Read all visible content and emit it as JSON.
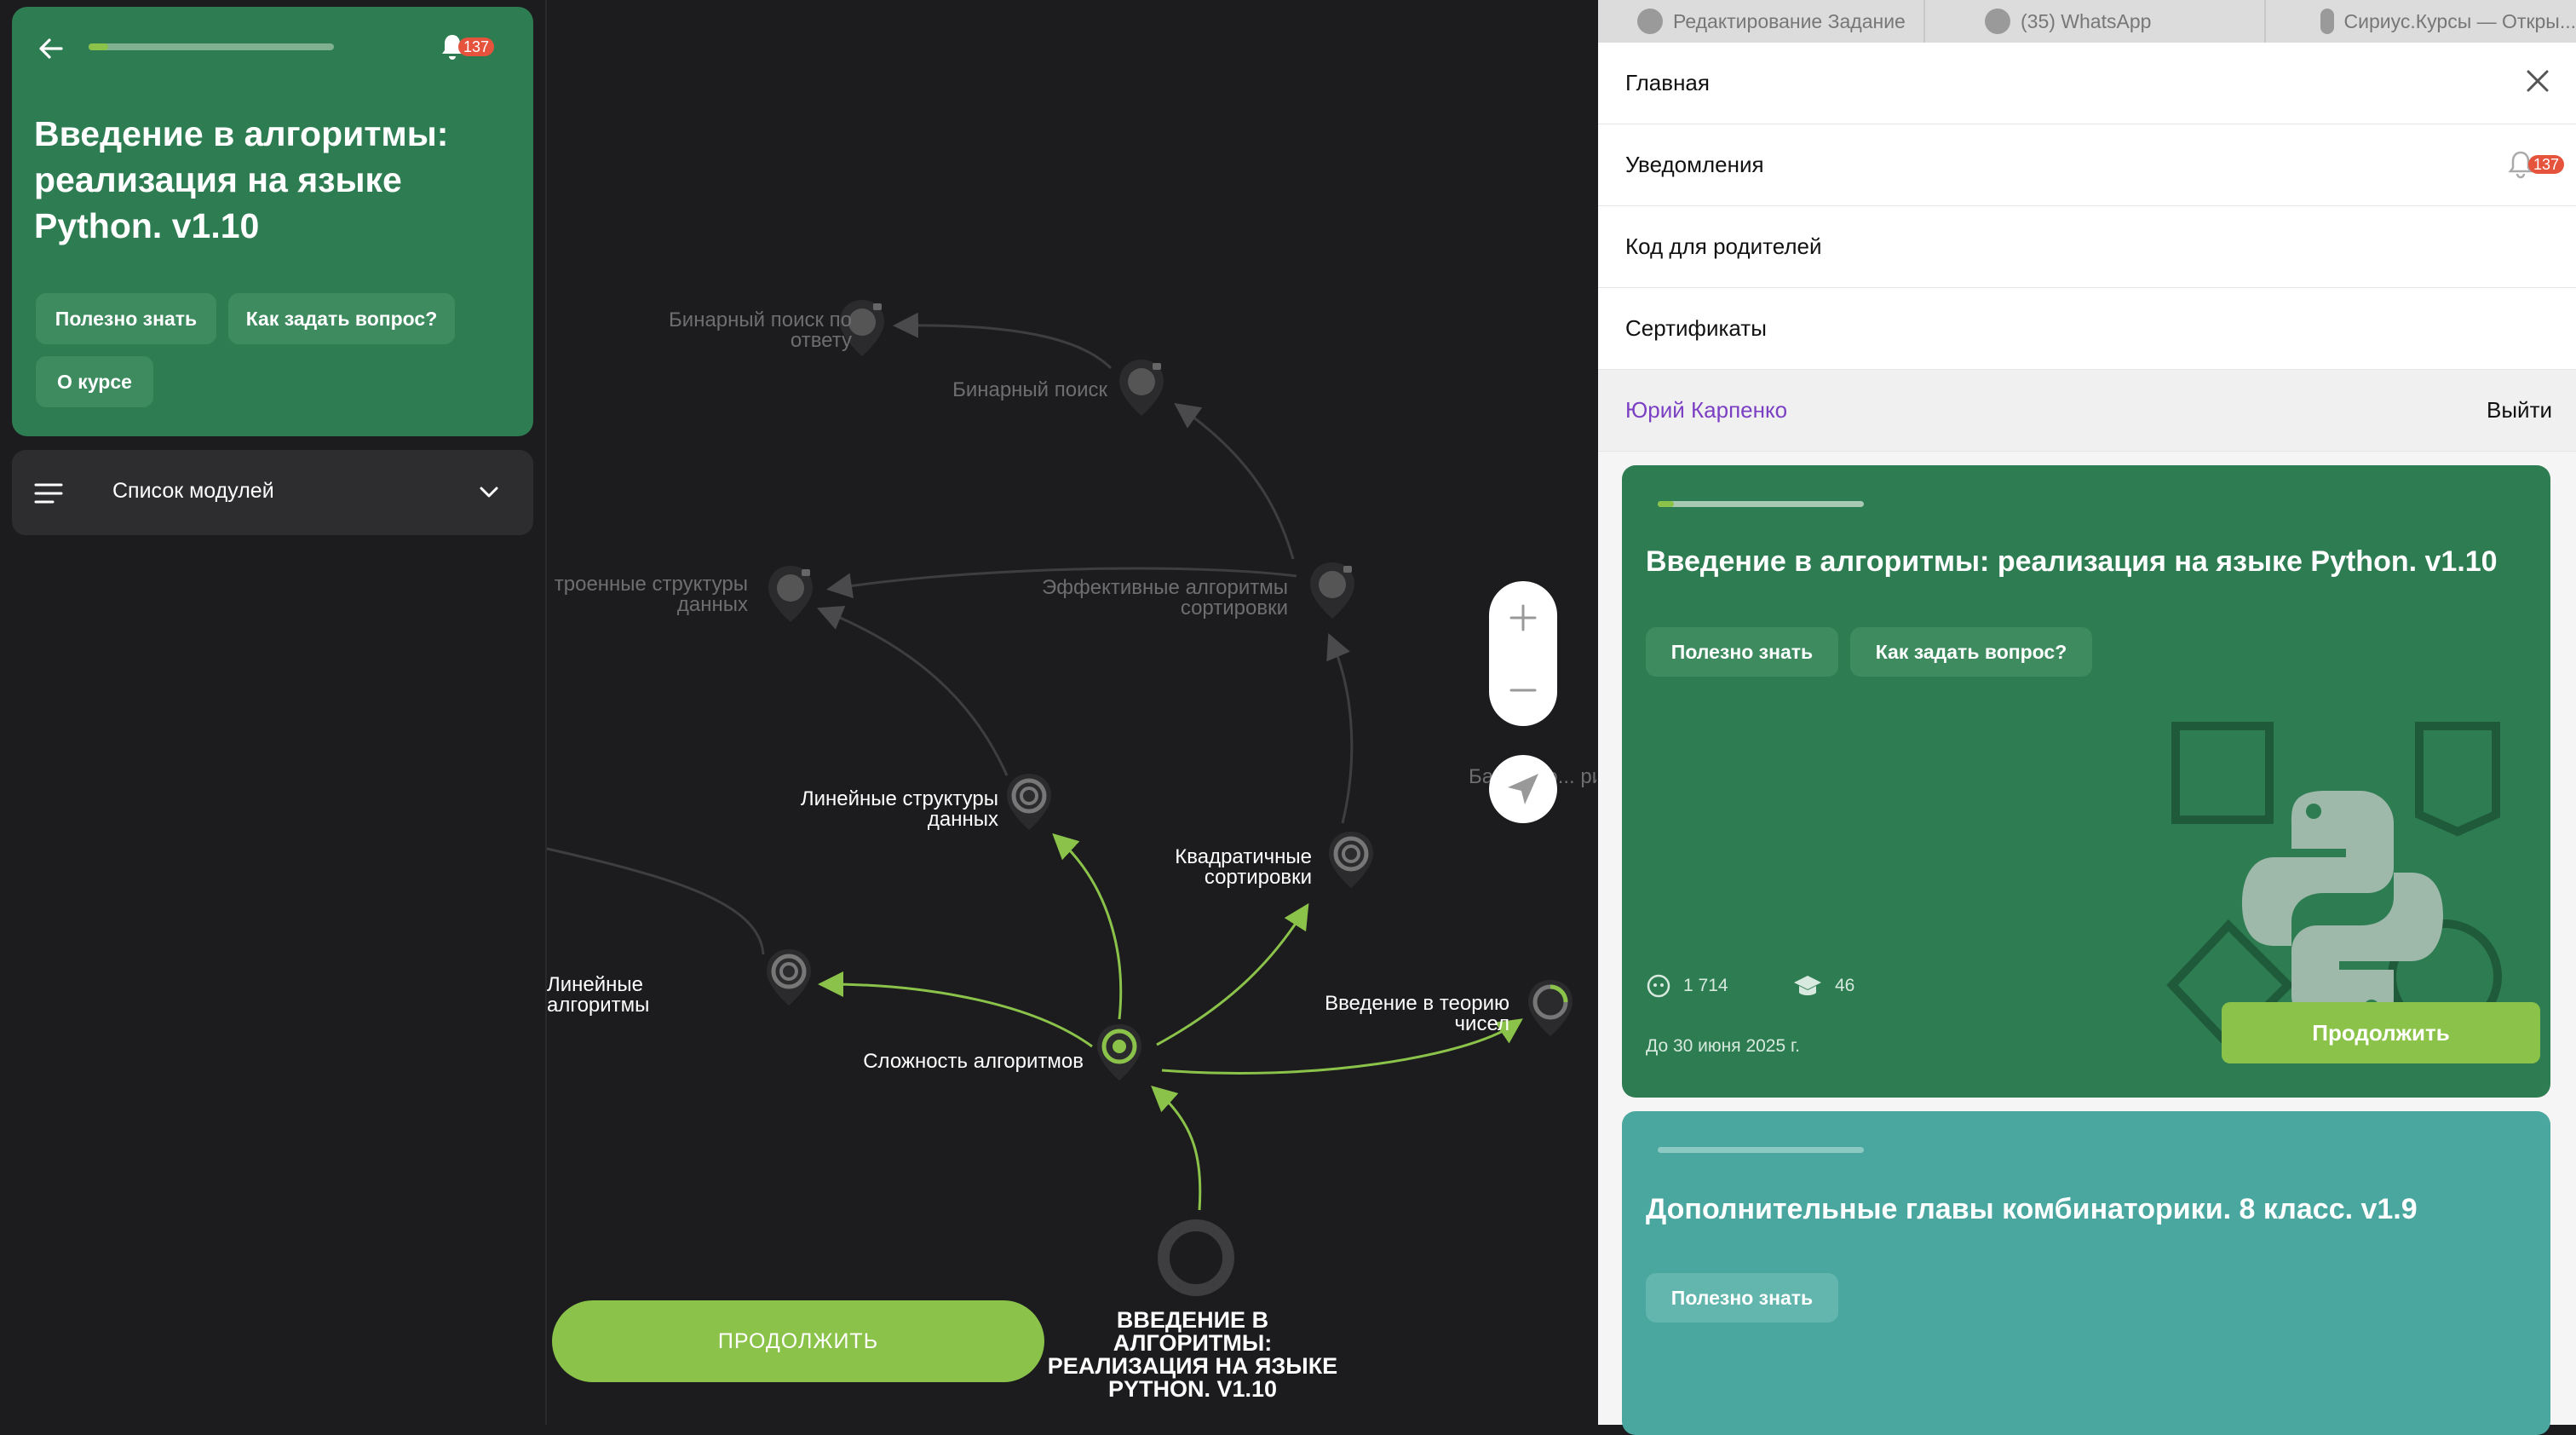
{
  "left": {
    "course_title": "Введение в алгоритмы: реализация на языке Python. v1.10",
    "progress_fraction": 0.08,
    "notifications_count": "137",
    "chips": [
      "Полезно знать",
      "Как задать вопрос?",
      "О курсе"
    ],
    "modules_label": "Список модулей"
  },
  "map": {
    "nodes": [
      {
        "label": "Бинарный поиск по ответу",
        "locked": true
      },
      {
        "label": "Бинарный поиск",
        "locked": true
      },
      {
        "label": "троенные структуры данных",
        "locked": true
      },
      {
        "label": "Эффективные алгоритмы сортировки",
        "locked": true
      },
      {
        "label": "Линейные структуры данных",
        "locked": false
      },
      {
        "label": "Квадратичные сортировки",
        "locked": false
      },
      {
        "label": "Линейные алгоритмы",
        "locked": false
      },
      {
        "label": "Сложность алгоритмов",
        "locked": false
      },
      {
        "label": "Введение в теорию чисел",
        "locked": false
      }
    ],
    "partial_label": "Ба... алго... рит...",
    "continue_label": "ПРОДОЛЖИТЬ",
    "start_title": "ВВЕДЕНИЕ В АЛГОРИТМЫ: РЕАЛИЗАЦИЯ НА ЯЗЫКЕ PYTHON. V1.10"
  },
  "browser_tabs": [
    {
      "label": "Редактирование Задание"
    },
    {
      "label": "(35) WhatsApp"
    },
    {
      "label": "Сириус.Курсы — Откры..."
    }
  ],
  "menu": {
    "home": "Главная",
    "notifications": "Уведомления",
    "notifications_count": "137",
    "parent_code": "Код для родителей",
    "certificates": "Сертификаты",
    "user_name": "Юрий Карпенко",
    "logout": "Выйти"
  },
  "cards": [
    {
      "title": "Введение в алгоритмы: реализация на языке Python. v1.10",
      "progress_fraction": 0.08,
      "chips": [
        "Полезно знать",
        "Как задать вопрос?"
      ],
      "students": "1 714",
      "graduates": "46",
      "deadline": "До 30 июня 2025 г.",
      "continue_label": "Продолжить",
      "color": "#2e7d52"
    },
    {
      "title": "Дополнительные главы комбинаторики. 8 класс. v1.9",
      "progress_fraction": 0,
      "chips": [
        "Полезно знать"
      ],
      "color": "#4aa79f"
    }
  ],
  "colors": {
    "accent": "#8bc34a",
    "card_green": "#2e7d52",
    "badge": "#e5533d",
    "user": "#7b3fc4"
  }
}
